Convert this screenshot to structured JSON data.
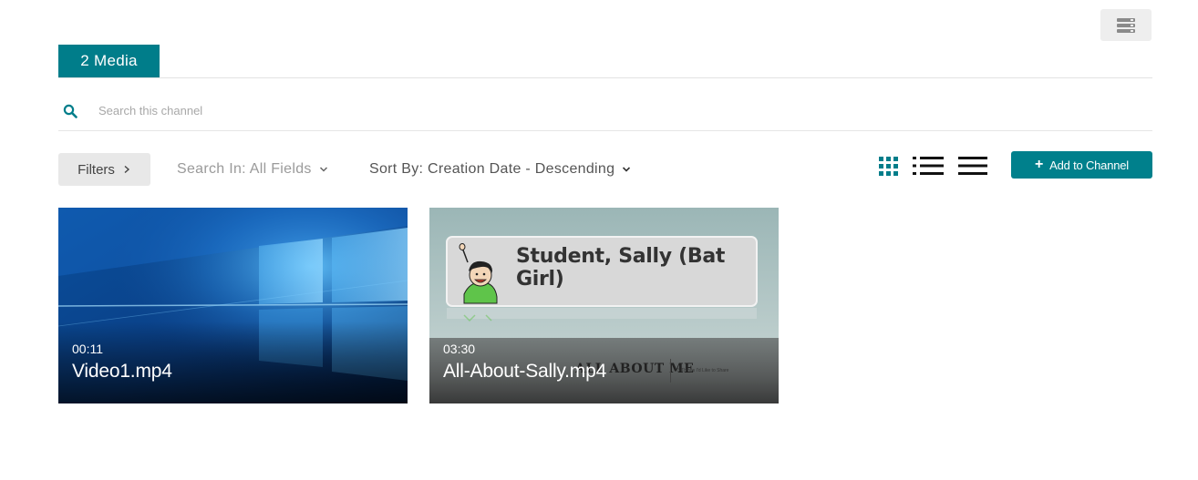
{
  "tab": {
    "label": "2 Media"
  },
  "search": {
    "placeholder": "Search this channel",
    "value": ""
  },
  "toolbar": {
    "filters_label": "Filters",
    "search_in_label": "Search In: All Fields",
    "sort_by_label": "Sort By: Creation Date - Descending",
    "add_button_label": "Add to Channel"
  },
  "colors": {
    "accent": "#007d8a",
    "button_gray": "#e8e8e8"
  },
  "icons": {
    "top_menu": "server-stack-icon",
    "search": "search-icon",
    "grid_view": "grid-view-icon",
    "detailed_view": "detailed-list-view-icon",
    "compact_view": "compact-list-view-icon",
    "plus": "plus-icon"
  },
  "media": [
    {
      "duration": "00:11",
      "title": "Video1.mp4"
    },
    {
      "duration": "03:30",
      "title": "All-About-Sally.mp4",
      "thumb_heading": "Student, Sally (Bat Girl)",
      "thumb_slide_title": "ALL ABOUT ME",
      "thumb_slide_subtitle": "3 Things I'd Like to Share"
    }
  ]
}
